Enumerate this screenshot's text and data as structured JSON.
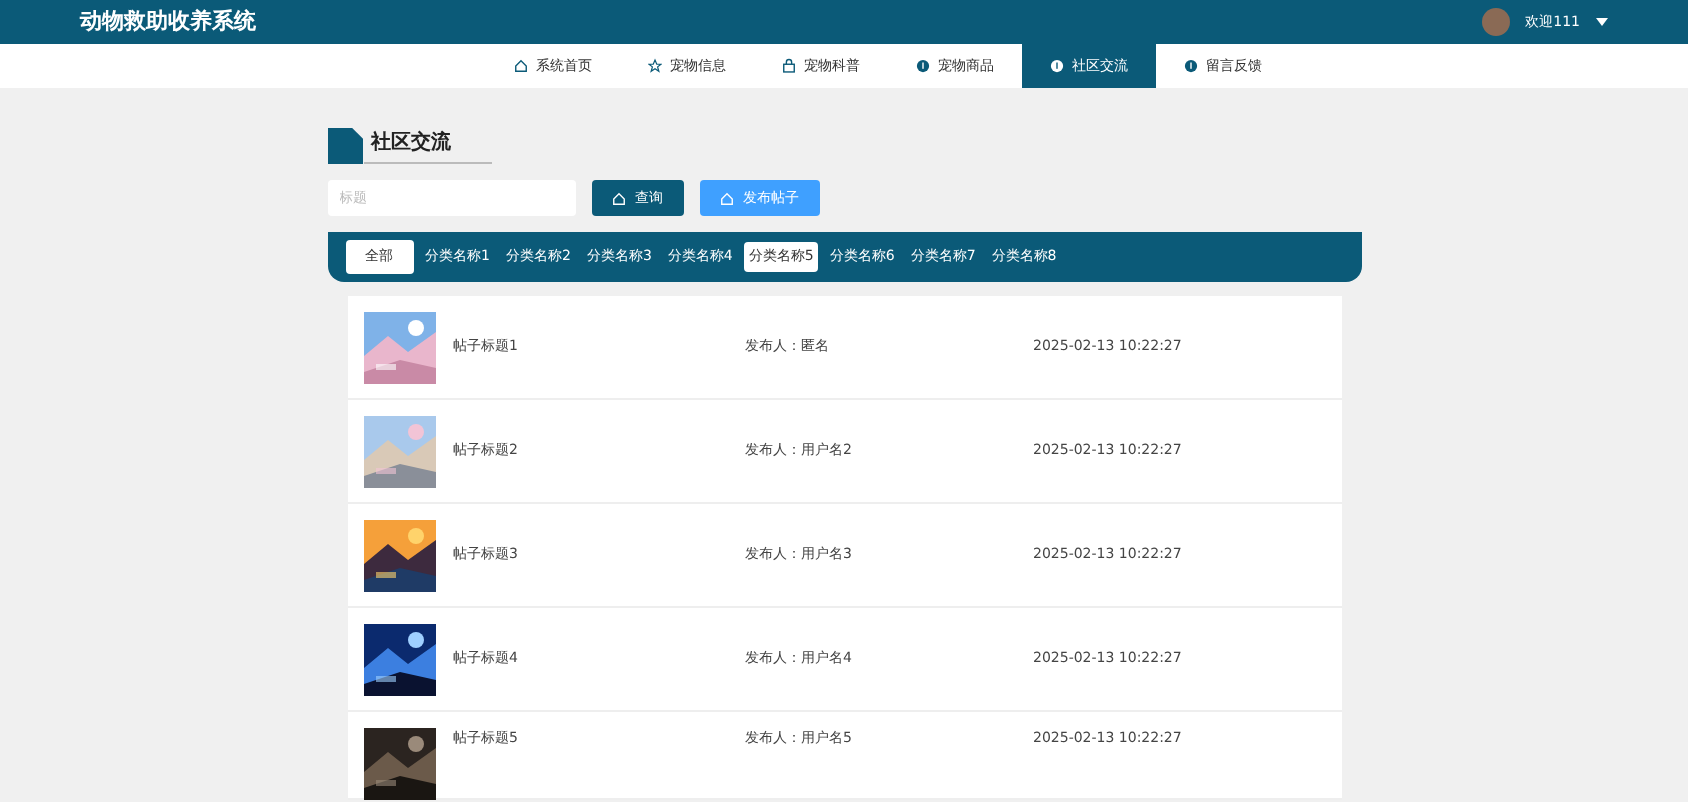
{
  "header": {
    "title": "动物救助收养系统",
    "user": "欢迎111"
  },
  "nav": [
    {
      "label": "系统首页",
      "selected": false
    },
    {
      "label": "宠物信息",
      "selected": false
    },
    {
      "label": "宠物科普",
      "selected": false
    },
    {
      "label": "宠物商品",
      "selected": false
    },
    {
      "label": "社区交流",
      "selected": true
    },
    {
      "label": "留言反馈",
      "selected": false
    }
  ],
  "section_title": "社区交流",
  "search": {
    "placeholder": "标题"
  },
  "buttons": [
    {
      "label": "查询",
      "kind": "dark"
    },
    {
      "label": "发布帖子",
      "kind": "light"
    }
  ],
  "categories": [
    {
      "label": "全部",
      "selected": true
    },
    {
      "label": "分类名称1",
      "selected": false
    },
    {
      "label": "分类名称2",
      "selected": false
    },
    {
      "label": "分类名称3",
      "selected": false
    },
    {
      "label": "分类名称4",
      "selected": false
    },
    {
      "label": "分类名称5",
      "selected": true
    },
    {
      "label": "分类名称6",
      "selected": false
    },
    {
      "label": "分类名称7",
      "selected": false
    },
    {
      "label": "分类名称8",
      "selected": false
    }
  ],
  "posts": [
    {
      "title": "帖子标题1",
      "author": "发布人：匿名",
      "time": "2025-02-13 10:22:27"
    },
    {
      "title": "帖子标题2",
      "author": "发布人：用户名2",
      "time": "2025-02-13 10:22:27"
    },
    {
      "title": "帖子标题3",
      "author": "发布人：用户名3",
      "time": "2025-02-13 10:22:27"
    },
    {
      "title": "帖子标题4",
      "author": "发布人：用户名4",
      "time": "2025-02-13 10:22:27"
    },
    {
      "title": "帖子标题5",
      "author": "发布人：用户名5",
      "time": "2025-02-13 10:22:27"
    }
  ]
}
